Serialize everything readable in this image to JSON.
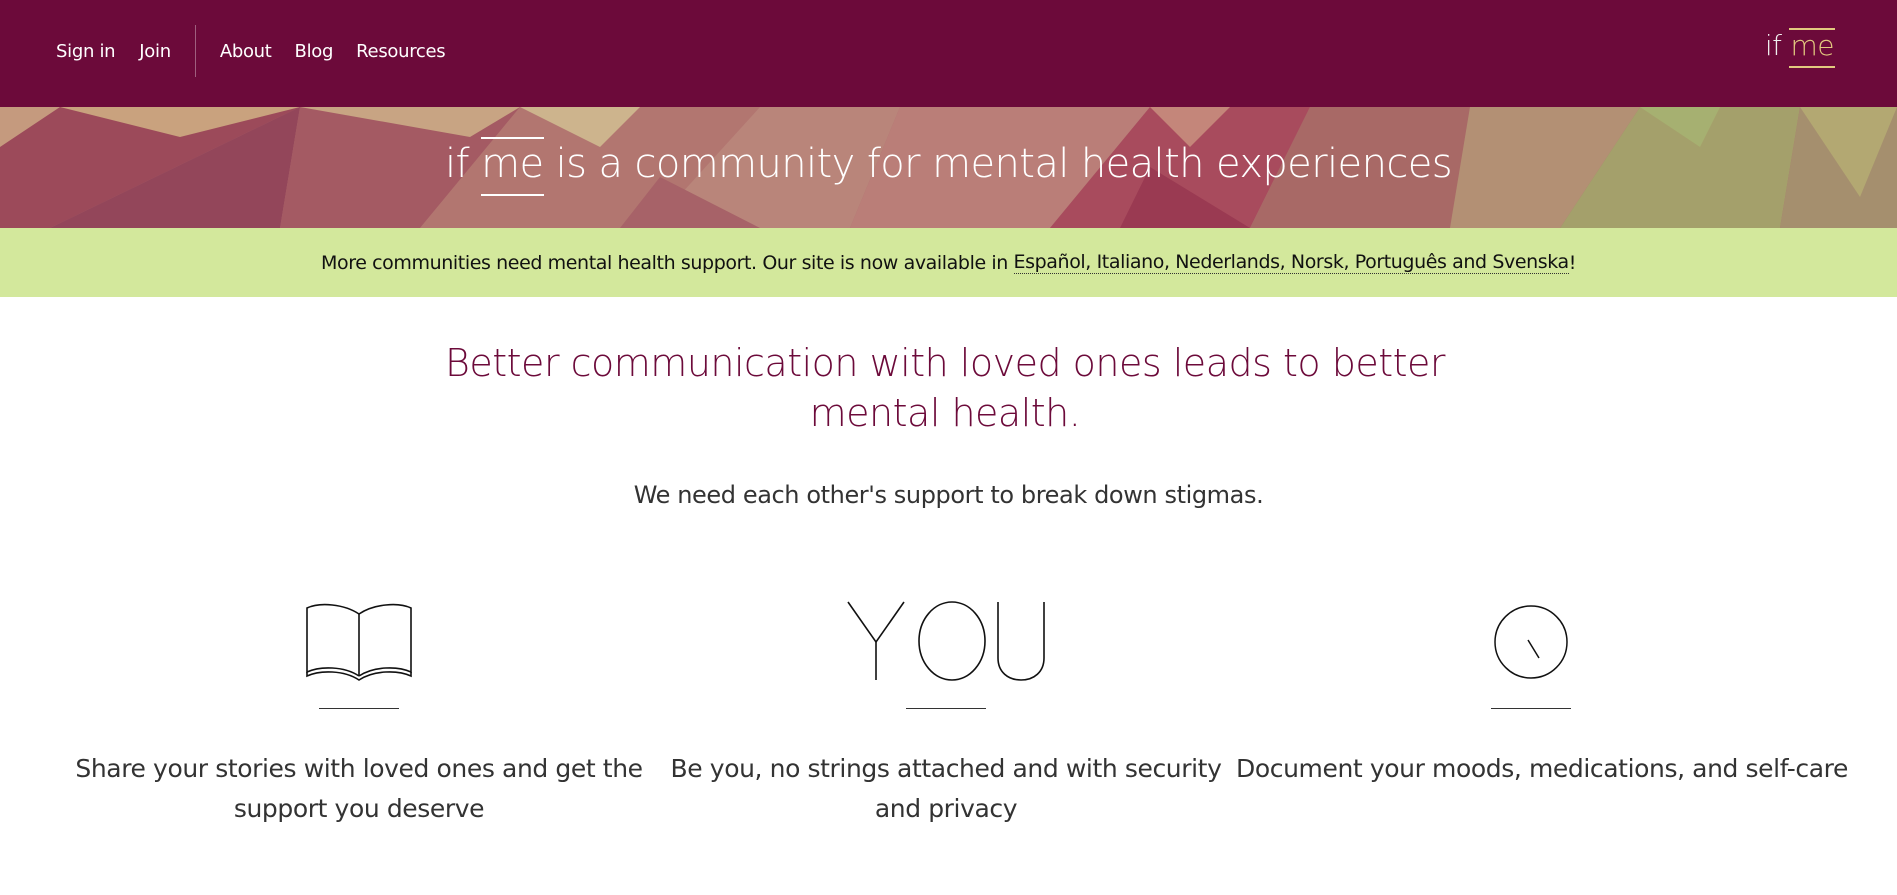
{
  "header": {
    "nav": {
      "sign_in": "Sign in",
      "join": "Join",
      "about": "About",
      "blog": "Blog",
      "resources": "Resources"
    },
    "logo": {
      "if_text": "if",
      "me_text": "me"
    }
  },
  "hero": {
    "title_prefix": "if",
    "title_me": "me",
    "title_rest": "is a community for mental health experiences"
  },
  "notice": {
    "text": "More communities need mental health support. Our site is now available in",
    "link": "Español, Italiano, Nederlands, Norsk, Português and Svenska",
    "suffix": "!"
  },
  "main": {
    "headline": "Better communication with loved ones leads to better mental health.",
    "subline": "We need each other's support to break down stigmas."
  },
  "features": [
    {
      "icon": "book-icon",
      "text": "Share your stories with loved ones and get the support you deserve"
    },
    {
      "icon": "you-icon",
      "icon_text": "YOU",
      "text": "Be you, no strings attached and with security and privacy"
    },
    {
      "icon": "clock-icon",
      "text": "Document your moods, medications, and self-care"
    }
  ],
  "colors": {
    "header_bg": "#6c0a3a",
    "logo_accent": "#e2c97f",
    "notice_bg": "#d3e89c",
    "headline": "#6c0a3a",
    "body_text": "#333333"
  }
}
